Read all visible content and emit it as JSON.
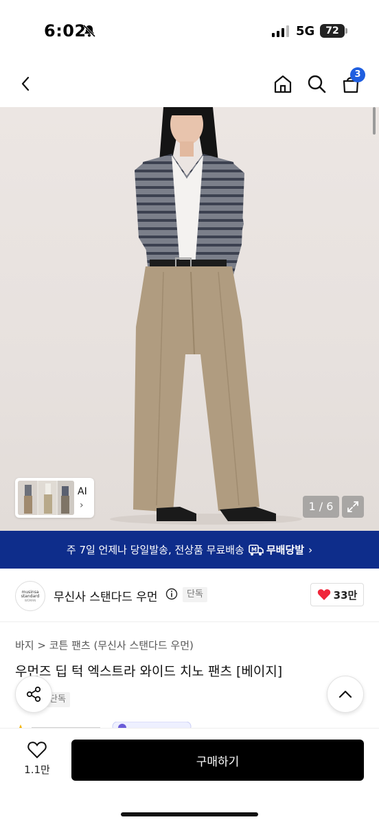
{
  "status_bar": {
    "time": "6:02",
    "network": "5G",
    "battery": "72"
  },
  "nav": {
    "cart_count": "3"
  },
  "hero": {
    "thumb_label": "AI",
    "counter": "1 / 6",
    "colors": {
      "background": "#ece6e3",
      "cardigan": "#7b7f8a",
      "stripe": "#3c4150",
      "pants": "#b09c80",
      "shoes": "#1a1a1a"
    }
  },
  "banner": {
    "text": "주 7일 언제나 당일발송, 전상품 무료배송",
    "service": "무배당발",
    "color": "#0e2d8b"
  },
  "brand": {
    "logo_line1": "musinsa",
    "logo_line2": "standard",
    "logo_line3": "WOMAN",
    "name": "무신사 스탠다드 우먼",
    "tag": "단독",
    "likes": "33만"
  },
  "product": {
    "breadcrumb": "바지 > 코튼 팬츠 (무신사 스탠다드 우먼)",
    "title": "우먼즈 딥 턱 엑스트라 와이드 치노 팬츠 [베이지]",
    "tag": "단독"
  },
  "bottom": {
    "wish_count": "1.1만",
    "buy_label": "구매하기"
  }
}
